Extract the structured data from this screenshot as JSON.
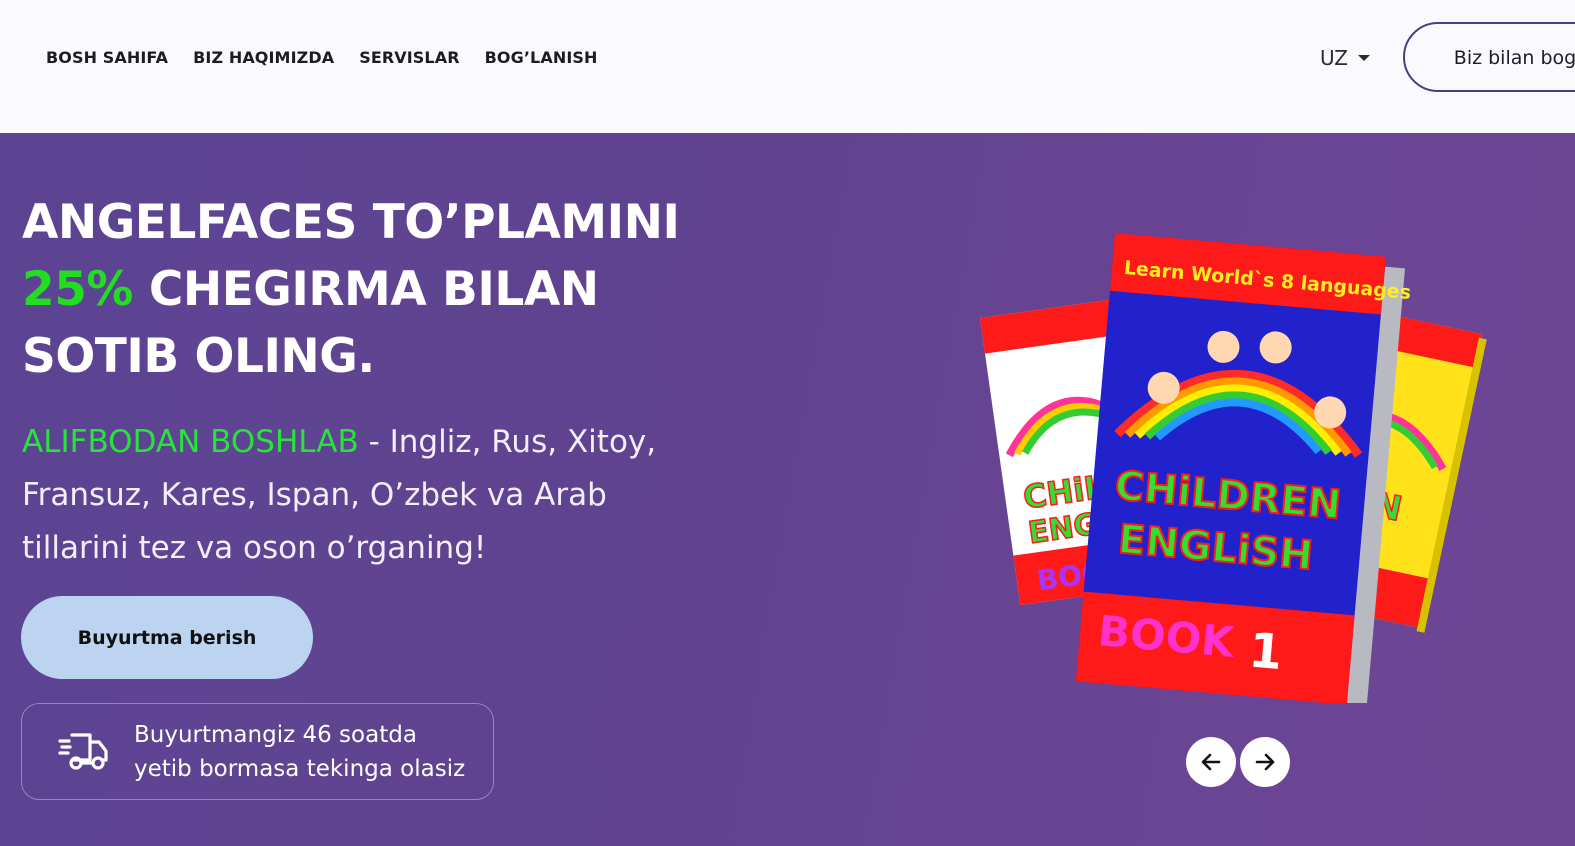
{
  "nav": {
    "items": [
      {
        "label": "BOSH SAHIFA"
      },
      {
        "label": "BIZ HAQIMIZDA"
      },
      {
        "label": "SERVISLAR"
      },
      {
        "label": "BOG’LANISH"
      }
    ]
  },
  "header": {
    "language": "UZ",
    "contact_label": "Biz bilan bog’la"
  },
  "hero": {
    "headline_line1": "ANGELFACES TO’PLAMINI",
    "headline_highlight": "25%",
    "headline_line2_rest": " CHEGIRMA BILAN",
    "headline_line3": "SOTIB OLING.",
    "sub_highlight": "ALIFBODAN BOSHLAB",
    "sub_rest": " - Ingliz, Rus, Xitoy, Fransuz, Kares, Ispan, O’zbek va Arab tillarini tez va oson o’rganing!",
    "order_label": "Buyurtma berish",
    "delivery_line1": "Buyurtmangiz 46 soatda",
    "delivery_line2": "yetib bormasa tekinga olasiz"
  },
  "books": {
    "banner": "Learn World`s 8 languages",
    "title_line1": "CHiLDREN",
    "title_line2": "ENGLiSH",
    "book_label": "BOOK",
    "book_number": "1",
    "colors": {
      "left_cover": "#ff1a1a",
      "main_cover": "#2222cc",
      "right_cover": "#ffe21a"
    }
  },
  "icons": {
    "truck": "delivery-truck-icon",
    "prev": "arrow-left-icon",
    "next": "arrow-right-icon",
    "caret": "chevron-down-icon"
  },
  "colors": {
    "accent_green": "#22dd22",
    "hero_bg": "#61438f",
    "button_bg": "#bcd4ef"
  }
}
